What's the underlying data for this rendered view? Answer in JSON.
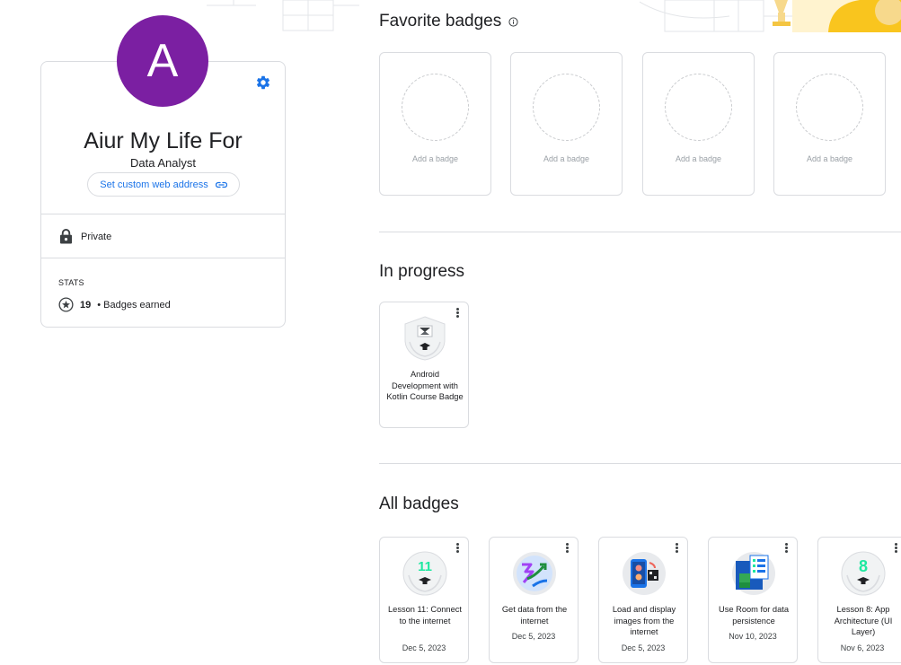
{
  "profile": {
    "avatar_letter": "A",
    "avatar_color": "#7b1fa2",
    "name": "Aiur My Life For",
    "title": "Data Analyst",
    "web_address_button": "Set custom web address",
    "privacy": "Private",
    "stats_label": "STATS",
    "badges_count": "19",
    "badges_label": "• Badges earned"
  },
  "favorites": {
    "title": "Favorite badges",
    "slots": [
      {
        "label": "Add a badge"
      },
      {
        "label": "Add a badge"
      },
      {
        "label": "Add a badge"
      },
      {
        "label": "Add a badge"
      }
    ]
  },
  "in_progress": {
    "title": "In progress",
    "badges": [
      {
        "name": "Android Development with Kotlin Course Badge",
        "icon": "course-badge-icon"
      }
    ]
  },
  "all_badges": {
    "title": "All badges",
    "badges": [
      {
        "name": "Lesson 11: Connect to the internet",
        "date": "Dec 5, 2023",
        "icon": "lesson-11-icon"
      },
      {
        "name": "Get data from the internet",
        "date": "Dec 5, 2023",
        "icon": "get-data-icon"
      },
      {
        "name": "Load and display images from the internet",
        "date": "Dec 5, 2023",
        "icon": "load-images-icon"
      },
      {
        "name": "Use Room for data persistence",
        "date": "Nov 10, 2023",
        "icon": "room-persistence-icon"
      },
      {
        "name": "Lesson 8: App Architecture (UI Layer)",
        "date": "Nov 6, 2023",
        "icon": "lesson-8-icon"
      }
    ]
  },
  "colors": {
    "accent": "#1a73e8",
    "border": "#dadce0",
    "badge_number_green": "#1ee8a0"
  }
}
